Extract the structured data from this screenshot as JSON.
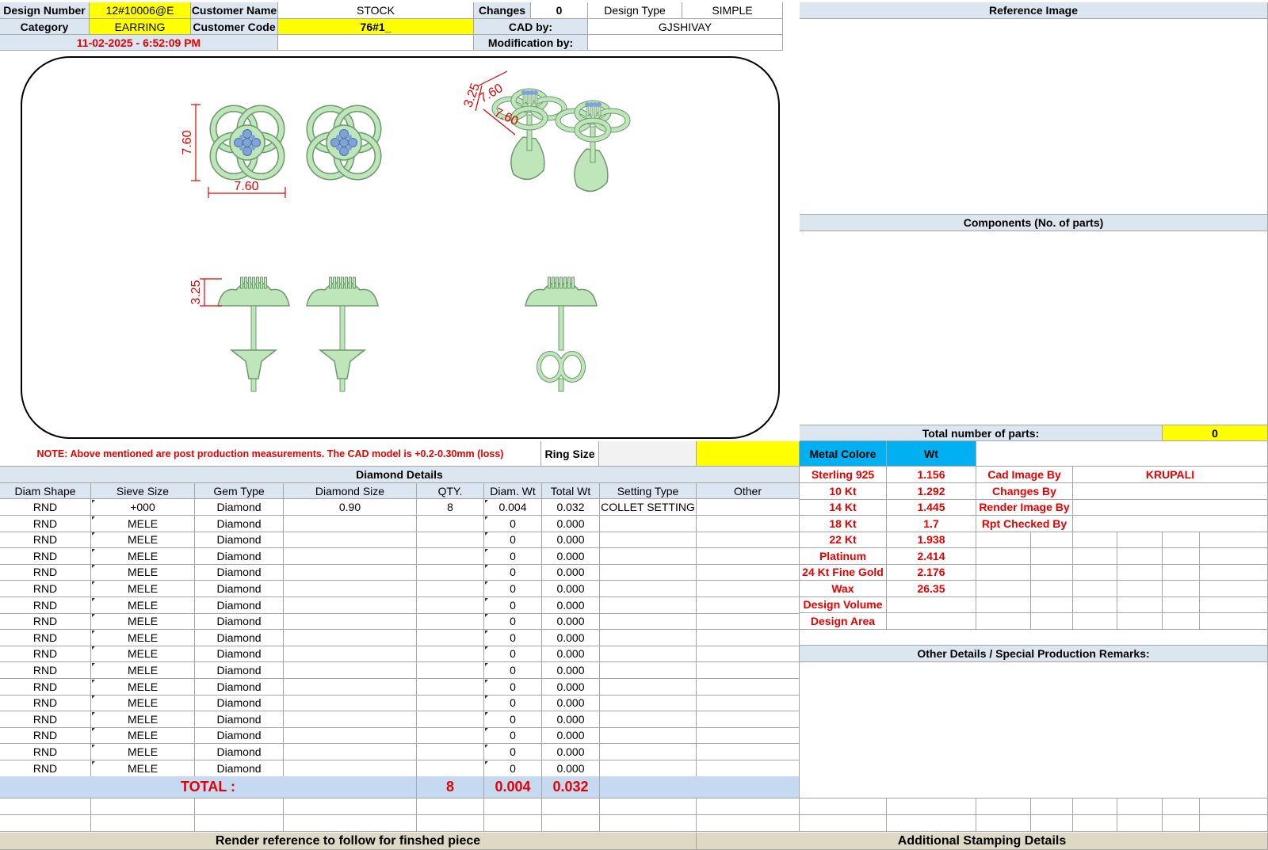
{
  "header": {
    "design_number_label": "Design Number",
    "design_number": "12#10006@E",
    "customer_name_label": "Customer Name",
    "customer_name": "STOCK",
    "changes_label": "Changes",
    "changes": "0",
    "design_type_label": "Design Type",
    "design_type": "SIMPLE",
    "category_label": "Category",
    "category": "EARRING",
    "customer_code_label": "Customer Code",
    "customer_code": "76#1_",
    "cad_by_label": "CAD by:",
    "cad_by": "GJSHIVAY",
    "datetime": "11-02-2025 - 6:52:09 PM",
    "modification_by_label": "Modification by:",
    "modification_by": ""
  },
  "drawing": {
    "dim_top_width": "7.60",
    "dim_top_height": "7.60",
    "dim_side_height": "3.25",
    "dim_iso_a": "3.25",
    "dim_iso_b": "7.60",
    "dim_iso_c": "7.60",
    "metal_color": "#bfe5bb",
    "stone_color": "#7ea3d8",
    "dimension_color": "#e00000"
  },
  "note": "NOTE: Above mentioned are post production measurements. The CAD model is +0.2-0.30mm (loss)",
  "ring_size_label": "Ring Size",
  "ring_size": "",
  "reference_image_title": "Reference Image",
  "components_title": "Components (No. of parts)",
  "total_parts_label": "Total number of parts:",
  "total_parts": "0",
  "diamond": {
    "title": "Diamond Details",
    "columns": [
      "Diam Shape",
      "Sieve Size",
      "Gem Type",
      "Diamond Size",
      "QTY.",
      "Diam. Wt",
      "Total Wt",
      "Setting Type",
      "Other"
    ],
    "rows": [
      [
        "RND",
        "+000",
        "Diamond",
        "0.90",
        "8",
        "0.004",
        "0.032",
        "COLLET SETTING",
        ""
      ],
      [
        "RND",
        "MELE",
        "Diamond",
        "",
        "",
        "0",
        "0.000",
        "",
        ""
      ],
      [
        "RND",
        "MELE",
        "Diamond",
        "",
        "",
        "0",
        "0.000",
        "",
        ""
      ],
      [
        "RND",
        "MELE",
        "Diamond",
        "",
        "",
        "0",
        "0.000",
        "",
        ""
      ],
      [
        "RND",
        "MELE",
        "Diamond",
        "",
        "",
        "0",
        "0.000",
        "",
        ""
      ],
      [
        "RND",
        "MELE",
        "Diamond",
        "",
        "",
        "0",
        "0.000",
        "",
        ""
      ],
      [
        "RND",
        "MELE",
        "Diamond",
        "",
        "",
        "0",
        "0.000",
        "",
        ""
      ],
      [
        "RND",
        "MELE",
        "Diamond",
        "",
        "",
        "0",
        "0.000",
        "",
        ""
      ],
      [
        "RND",
        "MELE",
        "Diamond",
        "",
        "",
        "0",
        "0.000",
        "",
        ""
      ],
      [
        "RND",
        "MELE",
        "Diamond",
        "",
        "",
        "0",
        "0.000",
        "",
        ""
      ],
      [
        "RND",
        "MELE",
        "Diamond",
        "",
        "",
        "0",
        "0.000",
        "",
        ""
      ],
      [
        "RND",
        "MELE",
        "Diamond",
        "",
        "",
        "0",
        "0.000",
        "",
        ""
      ],
      [
        "RND",
        "MELE",
        "Diamond",
        "",
        "",
        "0",
        "0.000",
        "",
        ""
      ],
      [
        "RND",
        "MELE",
        "Diamond",
        "",
        "",
        "0",
        "0.000",
        "",
        ""
      ],
      [
        "RND",
        "MELE",
        "Diamond",
        "",
        "",
        "0",
        "0.000",
        "",
        ""
      ],
      [
        "RND",
        "MELE",
        "Diamond",
        "",
        "",
        "0",
        "0.000",
        "",
        ""
      ],
      [
        "RND",
        "MELE",
        "Diamond",
        "",
        "",
        "0",
        "0.000",
        "",
        ""
      ]
    ],
    "total_label": "TOTAL :",
    "total_qty": "8",
    "total_diam_wt": "0.004",
    "total_wt": "0.032"
  },
  "metal": {
    "metal_colore_label": "Metal Colore",
    "wt_label": "Wt",
    "rows": [
      [
        "Sterling 925",
        "1.156"
      ],
      [
        "10 Kt",
        "1.292"
      ],
      [
        "14 Kt",
        "1.445"
      ],
      [
        "18 Kt",
        "1.7"
      ],
      [
        "22 Kt",
        "1.938"
      ],
      [
        "Platinum",
        "2.414"
      ],
      [
        "24 Kt Fine Gold",
        "2.176"
      ],
      [
        "Wax",
        "26.35"
      ],
      [
        "Design Volume",
        ""
      ],
      [
        "Design Area",
        ""
      ]
    ]
  },
  "credits": [
    [
      "Cad Image By",
      "KRUPALI"
    ],
    [
      "Changes By",
      ""
    ],
    [
      "Render Image By",
      ""
    ],
    [
      "Rpt Checked By",
      ""
    ]
  ],
  "other_details_title": "Other Details / Special Production Remarks:",
  "footer": {
    "render_reference": "Render reference to follow for finshed piece",
    "stamping": "Additional Stamping Details"
  }
}
